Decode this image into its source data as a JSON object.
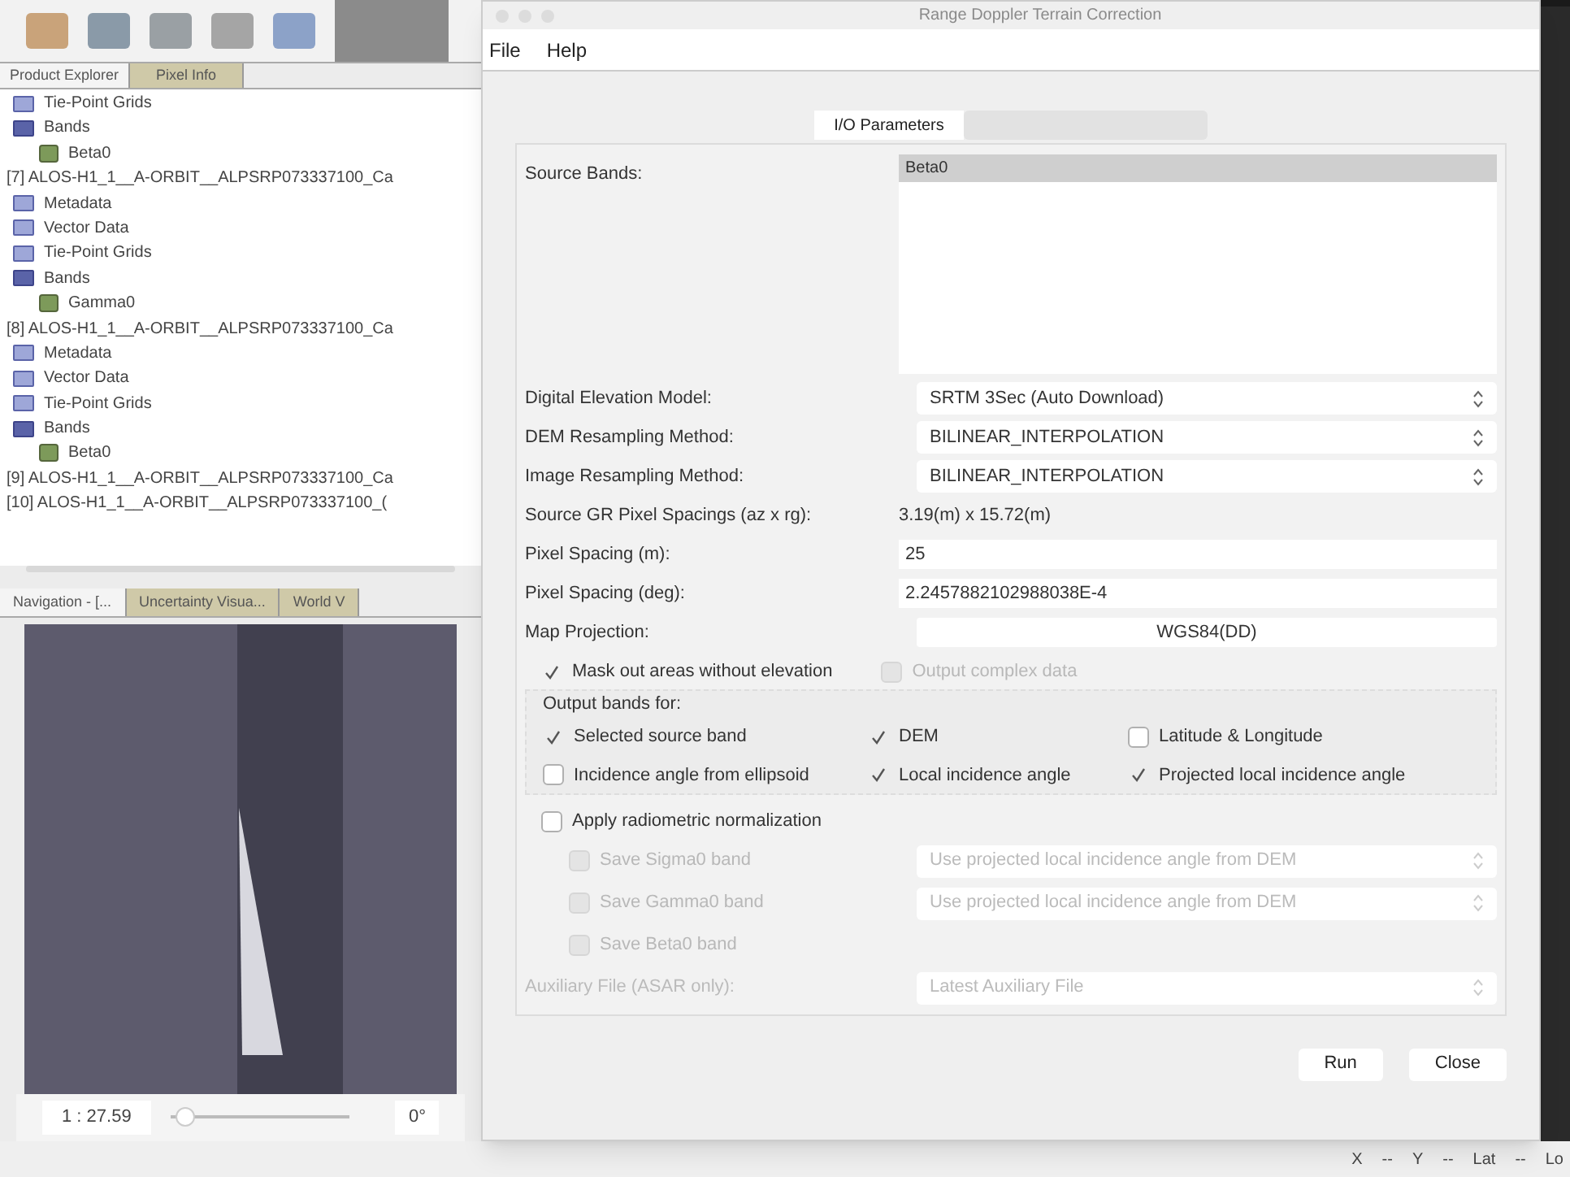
{
  "left_panel": {
    "explorer_tabs": [
      {
        "label": "Product Explorer",
        "selected": true
      },
      {
        "label": "Pixel Info",
        "selected": false
      }
    ],
    "tree": [
      {
        "label": "Tie-Point Grids",
        "kind": "folder"
      },
      {
        "label": "Bands",
        "kind": "bands",
        "children": [
          {
            "label": "Beta0",
            "kind": "band"
          }
        ]
      },
      {
        "label": "[7] ALOS-H1_1__A-ORBIT__ALPSRP073337100_Ca",
        "kind": "product",
        "children": [
          {
            "label": "Metadata",
            "kind": "folder"
          },
          {
            "label": "Vector Data",
            "kind": "folder"
          },
          {
            "label": "Tie-Point Grids",
            "kind": "folder"
          },
          {
            "label": "Bands",
            "kind": "bands",
            "children": [
              {
                "label": "Gamma0",
                "kind": "band"
              }
            ]
          }
        ]
      },
      {
        "label": "[8] ALOS-H1_1__A-ORBIT__ALPSRP073337100_Ca",
        "kind": "product",
        "children": [
          {
            "label": "Metadata",
            "kind": "folder"
          },
          {
            "label": "Vector Data",
            "kind": "folder"
          },
          {
            "label": "Tie-Point Grids",
            "kind": "folder"
          },
          {
            "label": "Bands",
            "kind": "bands",
            "children": [
              {
                "label": "Beta0",
                "kind": "band"
              }
            ]
          }
        ]
      },
      {
        "label": "[9] ALOS-H1_1__A-ORBIT__ALPSRP073337100_Ca",
        "kind": "product"
      },
      {
        "label": "[10] ALOS-H1_1__A-ORBIT__ALPSRP073337100_(",
        "kind": "product"
      }
    ],
    "nav_tabs": [
      {
        "label": "Navigation - [...",
        "selected": true
      },
      {
        "label": "Uncertainty Visua...",
        "selected": false
      },
      {
        "label": "World V",
        "selected": false
      }
    ],
    "scale": "1 : 27.59",
    "zoom": {
      "level": 0.03
    },
    "rotation": "0°"
  },
  "dialog": {
    "title": "Range Doppler Terrain Correction",
    "menu": [
      "File",
      "Help"
    ],
    "tabs": [
      {
        "label": "I/O Parameters",
        "selected": true
      },
      {
        "selected": false
      }
    ],
    "source_bands": {
      "label": "Source Bands:",
      "items": [
        {
          "label": "Beta0",
          "selected": true
        }
      ]
    },
    "rows": [
      {
        "kind": "combo",
        "label": "Digital Elevation Model:",
        "value": "SRTM 3Sec (Auto Download)",
        "disabled": false
      },
      {
        "kind": "combo",
        "label": "DEM Resampling Method:",
        "value": "BILINEAR_INTERPOLATION",
        "disabled": false
      },
      {
        "kind": "combo",
        "label": "Image Resampling Method:",
        "value": "BILINEAR_INTERPOLATION",
        "disabled": false
      },
      {
        "kind": "text",
        "label": "Source GR Pixel Spacings (az x rg):",
        "value": "3.19(m) x 15.72(m)"
      },
      {
        "kind": "input",
        "label": "Pixel Spacing (m):",
        "value": "25"
      },
      {
        "kind": "input",
        "label": "Pixel Spacing (deg):",
        "value": "2.2457882102988038E-4"
      },
      {
        "kind": "button",
        "label": "Map Projection:",
        "value": "WGS84(DD)"
      }
    ],
    "mask": {
      "label": "Mask out areas without elevation",
      "checked": true,
      "disabled": false
    },
    "complex": {
      "label": "Output complex data",
      "checked": false,
      "disabled": true
    },
    "output_bands": {
      "title": "Output bands for:",
      "items": [
        {
          "label": "Selected source band",
          "checked": true
        },
        {
          "label": "DEM",
          "checked": true
        },
        {
          "label": "Latitude & Longitude",
          "checked": false
        },
        {
          "label": "Incidence angle from ellipsoid",
          "checked": false
        },
        {
          "label": "Local incidence angle",
          "checked": true
        },
        {
          "label": "Projected local incidence angle",
          "checked": true
        }
      ]
    },
    "radiometric": {
      "label": "Apply radiometric normalization",
      "checked": false,
      "disabled": false
    },
    "save_bands": [
      {
        "label": "Save Sigma0 band",
        "checked": false,
        "disabled": true,
        "combo": "Use projected local incidence angle from DEM"
      },
      {
        "label": "Save Gamma0 band",
        "checked": false,
        "disabled": true,
        "combo": "Use projected local incidence angle from DEM"
      },
      {
        "label": "Save Beta0 band",
        "checked": false,
        "disabled": true
      }
    ],
    "aux": {
      "label": "Auxiliary File (ASAR only):",
      "value": "Latest Auxiliary File",
      "disabled": true
    },
    "buttons": [
      "Run",
      "Close"
    ]
  },
  "status_bar": [
    "X",
    "--",
    "Y",
    "--",
    "Lat",
    "--",
    "Lo"
  ]
}
